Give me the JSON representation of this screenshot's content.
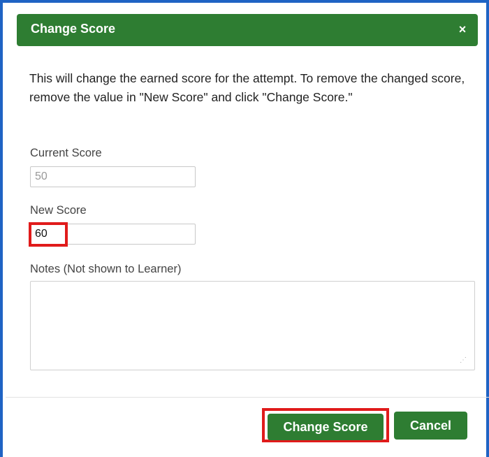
{
  "dialog": {
    "title": "Change Score",
    "close_symbol": "×",
    "description": "This will change the earned score for the attempt. To remove the changed score, remove the value in \"New Score\" and click \"Change Score.\""
  },
  "fields": {
    "current_score": {
      "label": "Current Score",
      "value": "50"
    },
    "new_score": {
      "label": "New Score",
      "value": "60"
    },
    "notes": {
      "label": "Notes (Not shown to Learner)",
      "value": ""
    }
  },
  "buttons": {
    "change_score": "Change Score",
    "cancel": "Cancel"
  },
  "colors": {
    "header_bg": "#2e7d32",
    "button_bg": "#2e7d32",
    "highlight": "#e01b1b",
    "frame_border": "#1f63c4"
  },
  "icons": {
    "close": "close-icon",
    "resize": "resize-grip-icon"
  }
}
